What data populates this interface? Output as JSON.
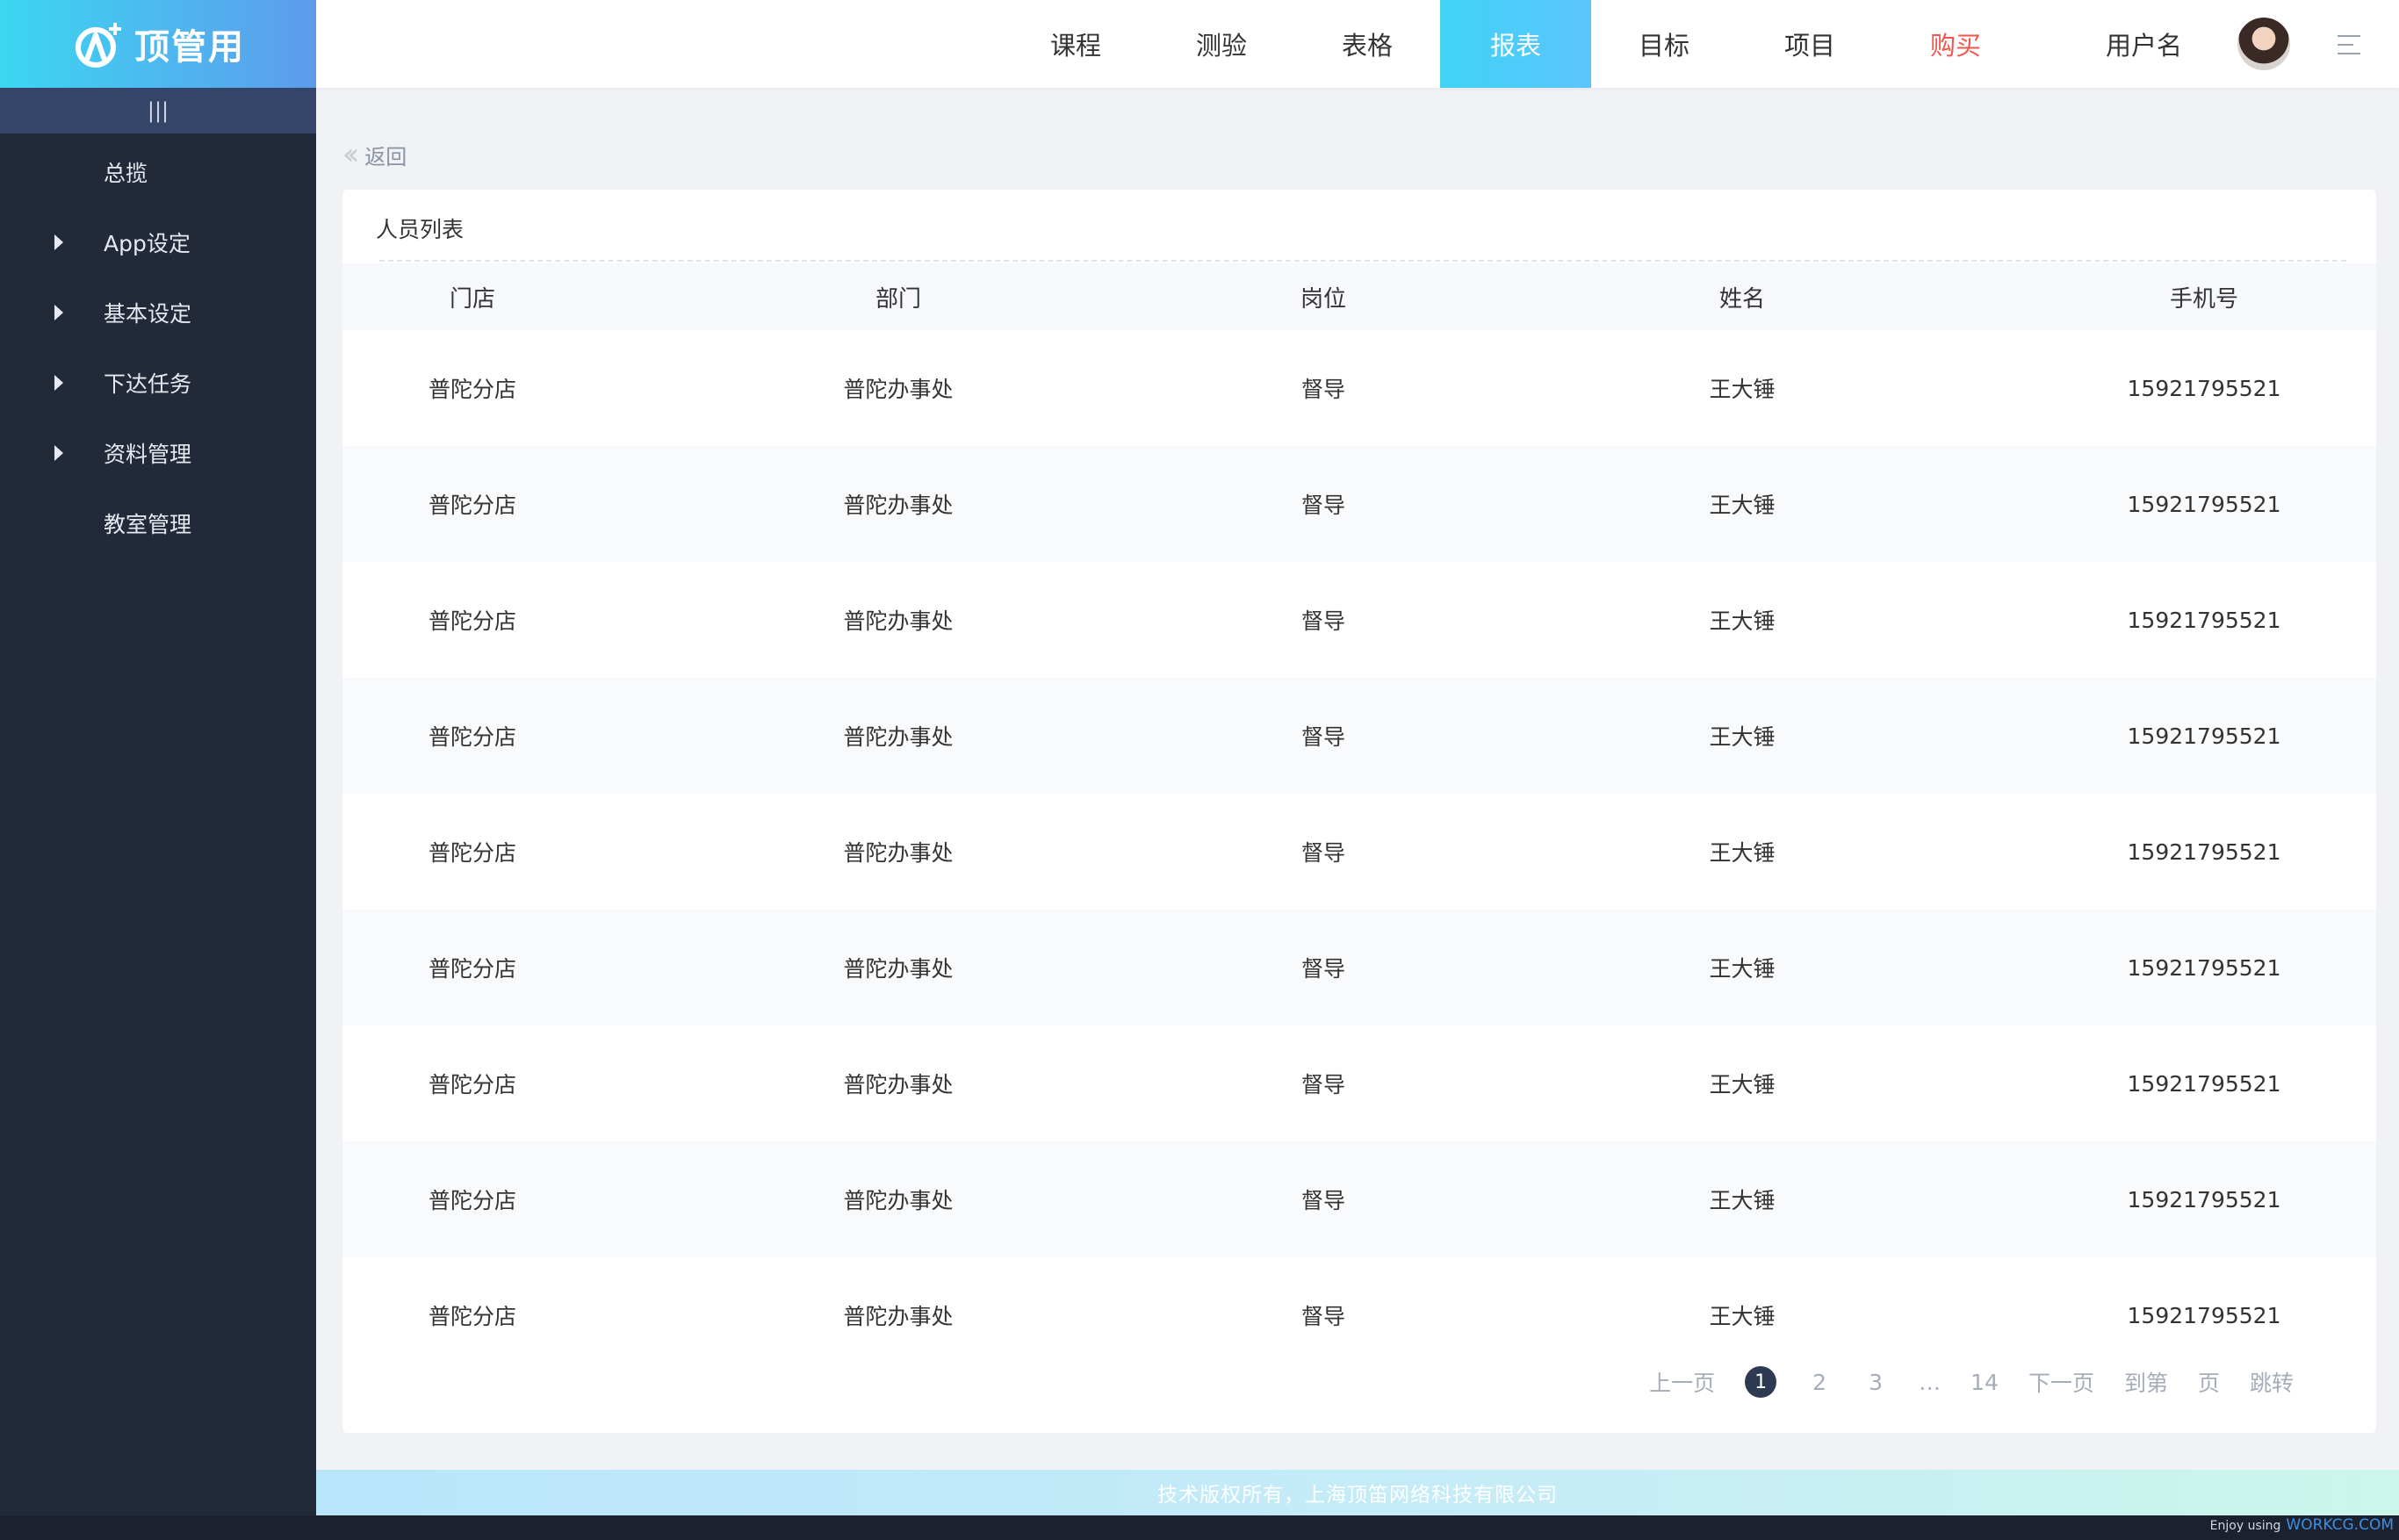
{
  "logo": {
    "text": "顶管用"
  },
  "sidebar": {
    "collapse_label": "|||",
    "items": [
      {
        "label": "总揽",
        "expandable": false
      },
      {
        "label": "App设定",
        "expandable": true
      },
      {
        "label": "基本设定",
        "expandable": true
      },
      {
        "label": "下达任务",
        "expandable": true
      },
      {
        "label": "资料管理",
        "expandable": true
      },
      {
        "label": "教室管理",
        "expandable": false
      }
    ]
  },
  "topbar": {
    "nav": [
      {
        "label": "课程"
      },
      {
        "label": "测验"
      },
      {
        "label": "表格"
      },
      {
        "label": "报表",
        "active": true
      },
      {
        "label": "目标"
      },
      {
        "label": "项目"
      },
      {
        "label": "购买",
        "accent": "#f2564e"
      }
    ],
    "username": "用户名",
    "accent_color": "#3fd3f7"
  },
  "main": {
    "back_label": "返回",
    "card_title": "人员列表",
    "table": {
      "columns": [
        "门店",
        "部门",
        "岗位",
        "姓名",
        "手机号"
      ],
      "rows": [
        [
          "普陀分店",
          "普陀办事处",
          "督导",
          "王大锤",
          "15921795521"
        ],
        [
          "普陀分店",
          "普陀办事处",
          "督导",
          "王大锤",
          "15921795521"
        ],
        [
          "普陀分店",
          "普陀办事处",
          "督导",
          "王大锤",
          "15921795521"
        ],
        [
          "普陀分店",
          "普陀办事处",
          "督导",
          "王大锤",
          "15921795521"
        ],
        [
          "普陀分店",
          "普陀办事处",
          "督导",
          "王大锤",
          "15921795521"
        ],
        [
          "普陀分店",
          "普陀办事处",
          "督导",
          "王大锤",
          "15921795521"
        ],
        [
          "普陀分店",
          "普陀办事处",
          "督导",
          "王大锤",
          "15921795521"
        ],
        [
          "普陀分店",
          "普陀办事处",
          "督导",
          "王大锤",
          "15921795521"
        ],
        [
          "普陀分店",
          "普陀办事处",
          "督导",
          "王大锤",
          "15921795521"
        ]
      ]
    },
    "pagination": {
      "prev": "上一页",
      "pages": [
        "1",
        "2",
        "3"
      ],
      "ellipsis": "…",
      "last": "14",
      "current": "1",
      "next": "下一页",
      "goto_prefix": "到第",
      "goto_suffix": "页",
      "jump": "跳转"
    }
  },
  "footer": {
    "copyright": "技术版权所有，上海顶笛网络科技有限公司",
    "credit_prefix": "Enjoy using",
    "credit_site": "WORKCG.COM"
  }
}
